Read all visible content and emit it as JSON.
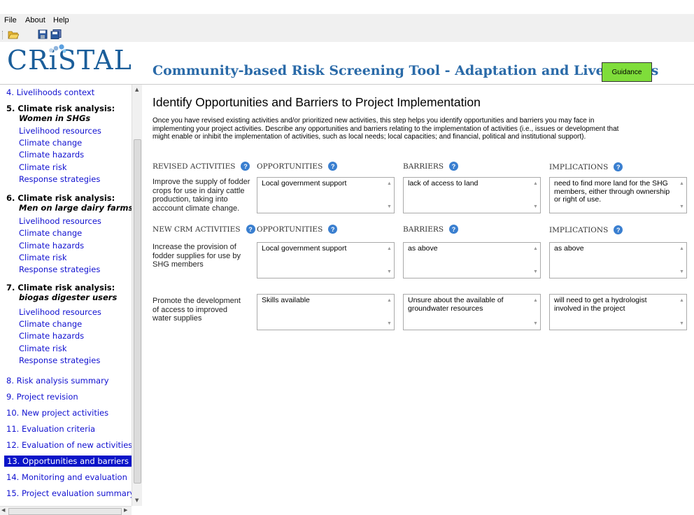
{
  "menu": {
    "file": "File",
    "about": "About",
    "help": "Help"
  },
  "toolbar": {
    "icons": [
      "open-folder-icon",
      "save-icon",
      "save-all-icon"
    ]
  },
  "header": {
    "logo": "CRiSTAL",
    "title": "Community-based Risk Screening Tool - Adaptation and Livelihoods",
    "guidance": "Guidance"
  },
  "sidebar": {
    "item4": "4. Livelihoods context",
    "s5_head": "5. Climate risk analysis:",
    "s5_sub": "Women in SHGs",
    "s6_head": "6. Climate risk analysis:",
    "s6_sub": "Men on large dairy farms",
    "s7_head": "7. Climate risk analysis:",
    "s7_sub": "biogas digester users",
    "sub_items": [
      "Livelihood resources",
      "Climate change",
      "Climate hazards",
      "Climate risk",
      "Response strategies"
    ],
    "item8": "8. Risk analysis summary",
    "item9": "9. Project revision",
    "item10": "10. New project activities",
    "item11": "11. Evaluation criteria",
    "item12": "12. Evaluation of new activities",
    "item13": "13. Opportunities and barriers",
    "item14": "14. Monitoring and evaluation",
    "item15": "15. Project evaluation summary"
  },
  "main": {
    "title": "Identify Opportunities and Barriers to Project Implementation",
    "intro": "Once you have revised existing activities and/or prioritized new activities, this step helps you identify opportunities and barriers you may face in implementing your project activities. Describe any opportunities and barriers relating to the implementation of activities (i.e., issues or development that might enable or inhibit the implementation of activities, such as local needs; local capacities; and financial, political and institutional support).",
    "headers": {
      "revised": "REVISED ACTIVITIES",
      "new_crm": "NEW CRM ACTIVITIES",
      "opportunities": "OPPORTUNITIES",
      "barriers": "BARRIERS",
      "implications": "IMPLICATIONS"
    },
    "rows": [
      {
        "activity": "Improve the supply of fodder crops for use in dairy cattle production, taking into acccount climate change.",
        "opportunities": "Local government support",
        "barriers": "lack of access to land",
        "implications": "need to find more land for the SHG members, either through ownership or right of use."
      },
      {
        "activity": "Increase the provision of fodder supplies for use by SHG members",
        "opportunities": "Local government support",
        "barriers": "as above",
        "implications": "as above"
      },
      {
        "activity": "Promote the development of access to improved water supplies",
        "opportunities": "Skills available",
        "barriers": "Unsure about the available of groundwater resources",
        "implications": "will need to get a hydrologist involved in the project"
      }
    ]
  },
  "colors": {
    "link": "#1010d0",
    "selected_bg": "#0a14c8",
    "guidance_bg": "#7fdd3a",
    "logo": "#1b5e9a",
    "title": "#2a6aa8"
  }
}
